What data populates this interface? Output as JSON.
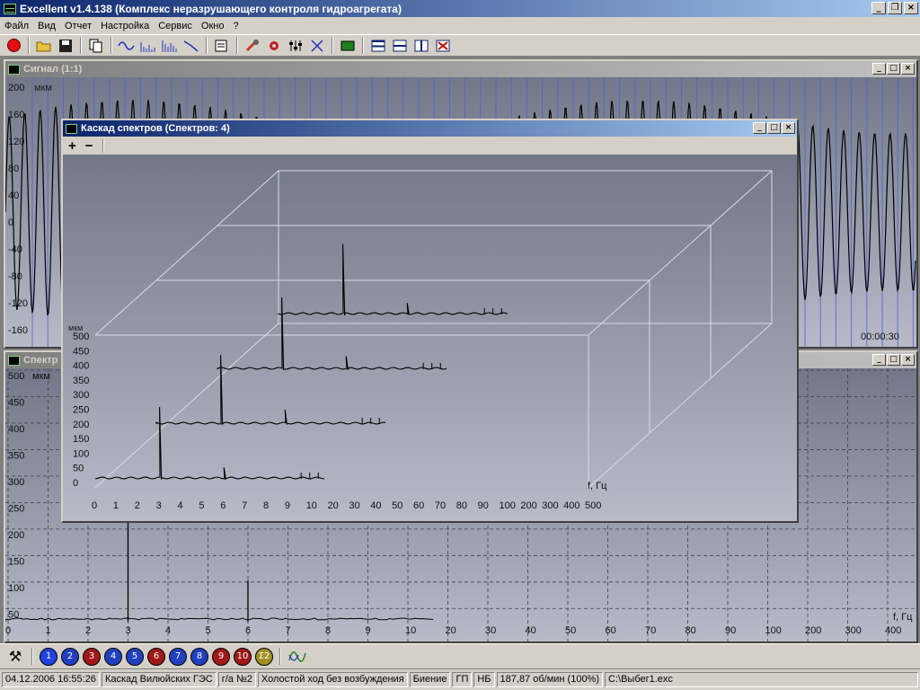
{
  "app": {
    "title": "Excellent v1.4.138 (Комплекс неразрушающего контроля гидроагрегата)"
  },
  "menu": [
    "Файл",
    "Вид",
    "Отчет",
    "Настройка",
    "Сервис",
    "Окно",
    "?"
  ],
  "toolbar_icons": [
    "record-icon",
    "open-icon",
    "save-icon",
    "copy-icon",
    "signal-icon",
    "spectrum-icon",
    "cascade-icon",
    "filter-icon",
    "properties-icon",
    "tools-icon",
    "settings-icon",
    "sliders-icon",
    "cross-icon",
    "device-icon",
    "tile-horizontal-icon",
    "tile-icon",
    "tile-vertical-icon",
    "close-all-icon"
  ],
  "signal_window": {
    "title": "Сигнал (1:1)",
    "unit": "мкм",
    "y_ticks": [
      "200",
      "160",
      "120",
      "80",
      "40",
      "0",
      "-40",
      "-80",
      "-120",
      "-160"
    ],
    "time_label": "00:00:30"
  },
  "spectrum_window": {
    "title": "Спектр",
    "unit": "мкм",
    "y_ticks": [
      "500",
      "450",
      "400",
      "350",
      "300",
      "250",
      "200",
      "150",
      "100",
      "50"
    ],
    "x_ticks": [
      "0",
      "1",
      "2",
      "3",
      "4",
      "5",
      "6",
      "7",
      "8",
      "9",
      "10",
      "20",
      "30",
      "40",
      "50",
      "60",
      "70",
      "80",
      "90",
      "100",
      "200",
      "300",
      "400"
    ],
    "x_label": "f, Гц"
  },
  "cascade_window": {
    "title": "Каскад спектров (Спектров: 4)",
    "zoom_in": "+",
    "zoom_out": "−",
    "unit": "мкм",
    "y_ticks": [
      "500",
      "450",
      "400",
      "350",
      "300",
      "250",
      "200",
      "150",
      "100",
      "50",
      "0"
    ],
    "x_ticks": [
      "0",
      "1",
      "2",
      "3",
      "4",
      "5",
      "6",
      "7",
      "8",
      "9",
      "10",
      "20",
      "30",
      "40",
      "50",
      "60",
      "70",
      "80",
      "90",
      "100",
      "200",
      "300",
      "400",
      "500"
    ],
    "x_label": "f, Гц"
  },
  "chart_data": {
    "type": "line",
    "y_unit": "мкм",
    "x_unit": "f, Гц",
    "ylim": [
      0,
      500
    ],
    "series_count": 4,
    "series": [
      {
        "peaks": [
          {
            "freq": 3.0,
            "amplitude": 250
          },
          {
            "freq": 6.0,
            "amplitude": 40
          }
        ]
      },
      {
        "peaks": [
          {
            "freq": 3.0,
            "amplitude": 240
          },
          {
            "freq": 6.0,
            "amplitude": 50
          }
        ]
      },
      {
        "peaks": [
          {
            "freq": 3.0,
            "amplitude": 250
          },
          {
            "freq": 6.0,
            "amplitude": 45
          }
        ]
      },
      {
        "peaks": [
          {
            "freq": 3.0,
            "amplitude": 245
          },
          {
            "freq": 6.0,
            "amplitude": 40
          }
        ]
      }
    ],
    "spectrum_peaks": [
      {
        "freq": 3.0,
        "amplitude": 455
      },
      {
        "freq": 6.0,
        "amplitude": 85
      }
    ]
  },
  "bottom_buttons": [
    {
      "label": "1",
      "color": "#2040e0"
    },
    {
      "label": "2",
      "color": "#2040c0"
    },
    {
      "label": "3",
      "color": "#a01818"
    },
    {
      "label": "4",
      "color": "#2040c0"
    },
    {
      "label": "5",
      "color": "#2040c0"
    },
    {
      "label": "6",
      "color": "#a01818"
    },
    {
      "label": "7",
      "color": "#2040c0"
    },
    {
      "label": "8",
      "color": "#2040c0"
    },
    {
      "label": "9",
      "color": "#a01818"
    },
    {
      "label": "10",
      "color": "#a01818"
    },
    {
      "label": "Σ2",
      "color": "#a09020"
    }
  ],
  "status": [
    "04.12.2006 16:55:26",
    "Каскад Вилюйских ГЭС",
    "г/а №2",
    "Холостой ход без возбуждения",
    "Биение",
    "ГП",
    "НБ",
    "187,87 об/мин (100%)",
    "С:\\Выбег1.exc"
  ]
}
